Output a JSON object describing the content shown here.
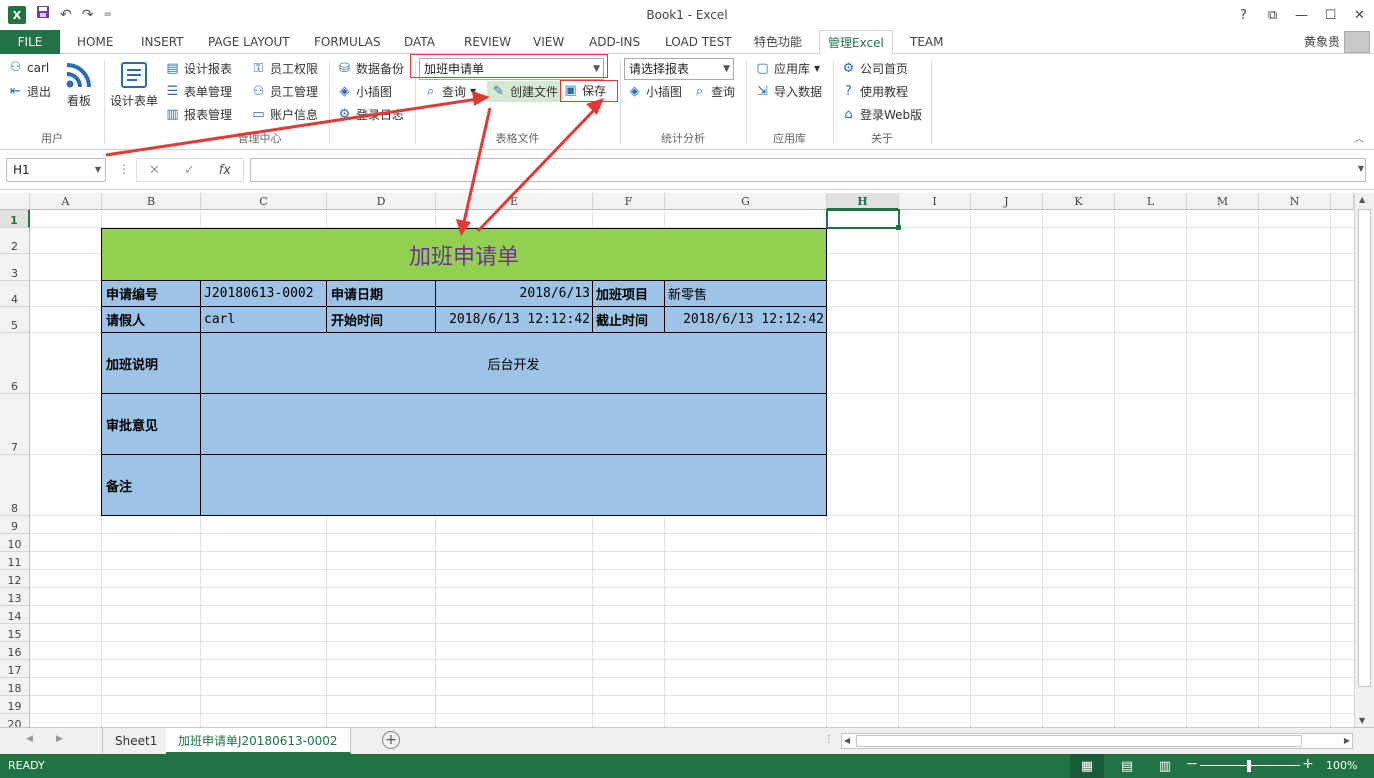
{
  "window": {
    "title": "Book1 - Excel"
  },
  "qat": {
    "logo": "X",
    "save_icon": "save-icon",
    "undo": "↶",
    "redo": "↷",
    "customize": "="
  },
  "winctrls": {
    "help": "?",
    "restore": "⧉",
    "minimize": "—",
    "maximize": "☐",
    "close": "✕"
  },
  "tabs": [
    "FILE",
    "HOME",
    "INSERT",
    "PAGE LAYOUT",
    "FORMULAS",
    "DATA",
    "REVIEW",
    "VIEW",
    "ADD-INS",
    "LOAD TEST",
    "特色功能",
    "管理Excel",
    "TEAM"
  ],
  "user_name": "黄象贵",
  "ribbon": {
    "user_group": {
      "label": "用户",
      "user": "carl",
      "logout": "退出",
      "board": "看板"
    },
    "mgmt_group": {
      "label": "管理中心",
      "design_form": "设计表单",
      "design_report": "设计报表",
      "form_mgmt": "表单管理",
      "report_mgmt": "报表管理",
      "emp_perm": "员工权限",
      "emp_mgmt": "员工管理",
      "account_info": "账户信息",
      "data_backup": "数据备份",
      "small_plugin": "小插图",
      "login_log": "登录日志"
    },
    "file_group": {
      "label": "表格文件",
      "form_select": "加班申请单",
      "query": "查询",
      "create_file": "创建文件",
      "save": "保存"
    },
    "stats_group": {
      "label": "统计分析",
      "report_select": "请选择报表",
      "small_plugin": "小插图",
      "query": "查询"
    },
    "app_group": {
      "label": "应用库",
      "app_store": "应用库",
      "import_data": "导入数据"
    },
    "about_group": {
      "label": "关于",
      "home": "公司首页",
      "tutorial": "使用教程",
      "web_login": "登录Web版"
    }
  },
  "formula": {
    "namebox": "H1",
    "cancel": "✕",
    "enter": "✓",
    "fx": "fx",
    "value": ""
  },
  "columns": [
    "A",
    "B",
    "C",
    "D",
    "E",
    "F",
    "G",
    "H",
    "I",
    "J",
    "K",
    "L",
    "M",
    "N"
  ],
  "rows": [
    "1",
    "2",
    "3",
    "4",
    "5",
    "6",
    "7",
    "8",
    "9",
    "10",
    "11",
    "12",
    "13",
    "14",
    "15",
    "16",
    "17",
    "18",
    "19",
    "20"
  ],
  "form": {
    "title": "加班申请单",
    "app_no_label": "申请编号",
    "app_no": "J20180613-0002",
    "app_date_label": "申请日期",
    "app_date": "2018/6/13",
    "project_label": "加班项目",
    "project": "新零售",
    "person_label": "请假人",
    "person": "carl",
    "start_label": "开始时间",
    "start": "2018/6/13 12:12:42",
    "end_label": "截止时间",
    "end": "2018/6/13 12:12:42",
    "desc_label": "加班说明",
    "desc": "后台开发",
    "approval_label": "审批意见",
    "approval": "",
    "remark_label": "备注",
    "remark": ""
  },
  "sheets": [
    "Sheet1",
    "加班申请单J20180613-0002"
  ],
  "status": {
    "ready": "READY",
    "zoom": "100%"
  },
  "colors": {
    "excel_green": "#217346",
    "form_title_bg": "#92d050",
    "form_cell_bg": "#9dc3e6",
    "title_text": "#7030a0",
    "annotation": "#e53935"
  }
}
